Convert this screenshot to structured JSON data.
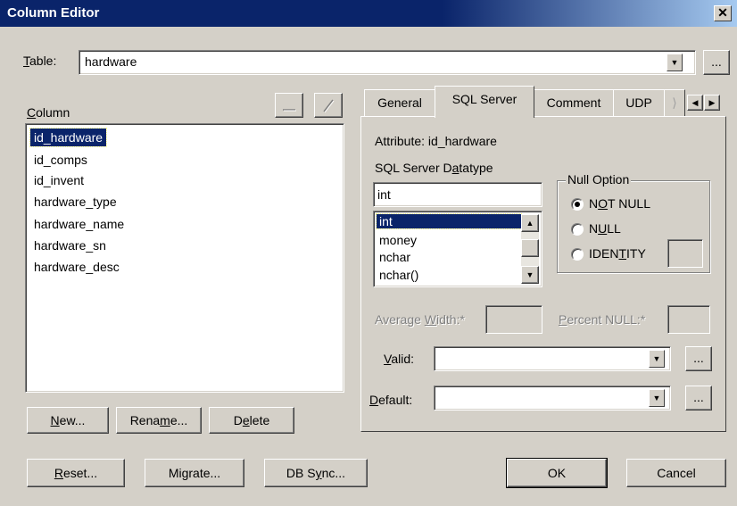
{
  "window": {
    "title": "Column Editor",
    "close_glyph": "✕"
  },
  "table": {
    "label_u": "T",
    "label_rest": "able:",
    "value": "hardware",
    "browse": "..."
  },
  "column": {
    "label_u": "C",
    "label_rest": "olumn",
    "items": [
      "id_hardware",
      "id_comps",
      "id_invent",
      "hardware_type",
      "hardware_name",
      "hardware_sn",
      "hardware_desc"
    ],
    "selected": "id_hardware"
  },
  "buttons": {
    "new_u": "N",
    "new_rest": "ew...",
    "rename_a": "Rena",
    "rename_u": "m",
    "rename_b": "e...",
    "delete_a": "D",
    "delete_u": "e",
    "delete_b": "lete",
    "reset_u": "R",
    "reset_rest": "eset...",
    "migrate_a": "Mi",
    "migrate_u": "g",
    "migrate_b": "rate...",
    "dbsync_a": "DB S",
    "dbsync_u": "y",
    "dbsync_b": "nc...",
    "ok": "OK",
    "cancel": "Cancel"
  },
  "tabs": [
    "General",
    "SQL Server",
    "Comment",
    "UDP"
  ],
  "sqlserver": {
    "attribute_label": "Attribute:",
    "attribute_value": "id_hardware",
    "datatype_a": "SQL Server D",
    "datatype_u": "a",
    "datatype_b": "tatype",
    "datatype_value": "int",
    "datatype_list": [
      "int",
      "money",
      "nchar",
      "nchar()"
    ],
    "datatype_selected": "int",
    "null_option": {
      "title": "Null Option",
      "not_null_a": "N",
      "not_null_u": "O",
      "not_null_b": "T NULL",
      "null_a": "N",
      "null_u": "U",
      "null_b": "LL",
      "identity_a": "IDEN",
      "identity_u": "T",
      "identity_b": "ITY",
      "selected": "NOT NULL"
    },
    "avg_width_a": "Average ",
    "avg_width_u": "W",
    "avg_width_b": "idth:*",
    "pct_null_u": "P",
    "pct_null_b": "ercent NULL:*",
    "valid_u": "V",
    "valid_b": "alid:",
    "default_u": "D",
    "default_b": "efault:",
    "browse": "..."
  }
}
